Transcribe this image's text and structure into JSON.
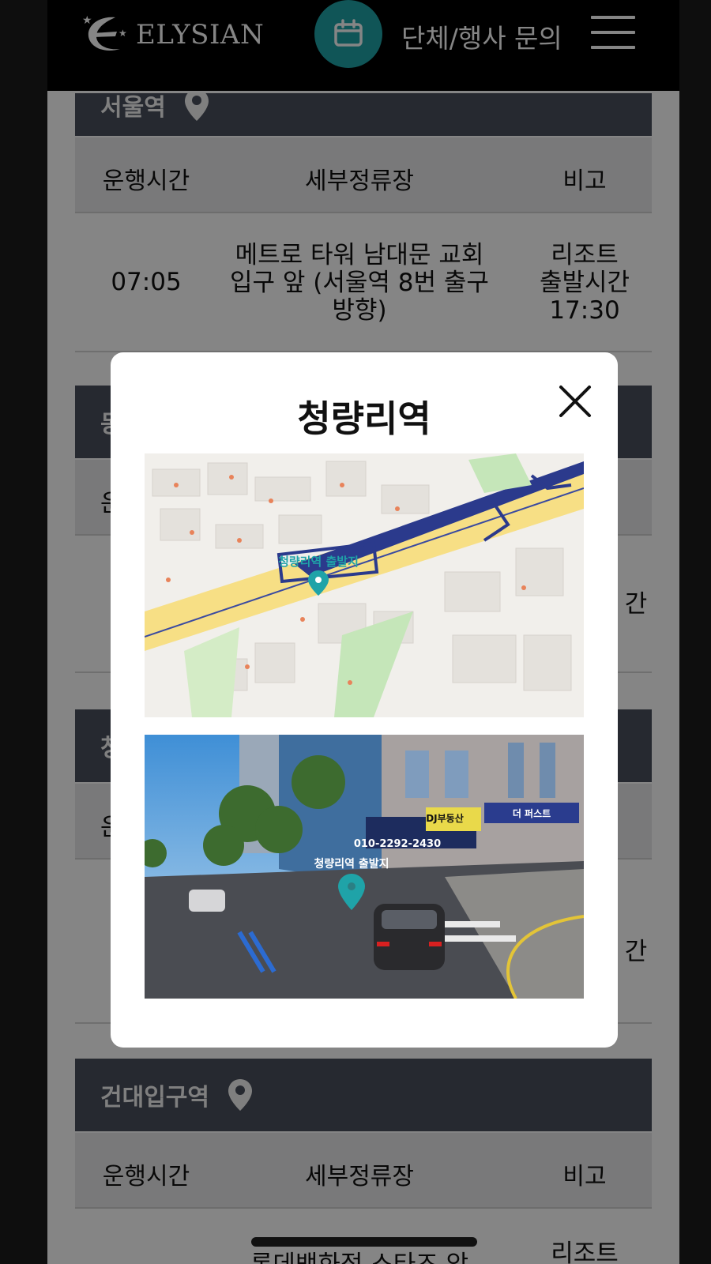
{
  "header": {
    "logo_text": "ELYSIAN",
    "calendar_icon": "calendar-icon",
    "inquiry_label": "단체/행사 문의",
    "menu_icon": "hamburger-menu-icon"
  },
  "table_columns": {
    "time": "운행시간",
    "stop": "세부정류장",
    "note": "비고"
  },
  "sections": {
    "seoul": {
      "name": "서울역",
      "row": {
        "time": "07:05",
        "stop_lines": [
          "메트로 타워 남대문 교회",
          "입구 앞 (서울역 8번 출구",
          "방향)"
        ],
        "note_lines": [
          "리조트",
          "출발시간",
          "17:30"
        ]
      }
    },
    "konkuk": {
      "name": "건대입구역",
      "row_note_partial": "리조트",
      "row_stop_partial": "롯데백화점 스타즈 앞"
    }
  },
  "obscured_fragments": {
    "head2": "동",
    "col2": "운",
    "note2": "간",
    "head3": "청",
    "col3": "운",
    "note3": "간"
  },
  "modal": {
    "title": "청량리역",
    "map_label": "청량리역 출발지",
    "photo_label": "청량리역 출발지",
    "photo_signs": {
      "phone": "010-2292-2430",
      "realty": "DJ부동산",
      "realty2": "더 퍼스트"
    }
  },
  "colors": {
    "header_bg": "#000000",
    "accent_teal": "#1fa3a8",
    "section_head_bg": "#4a4f5c",
    "overlay": "rgba(0,0,0,0.48)"
  }
}
